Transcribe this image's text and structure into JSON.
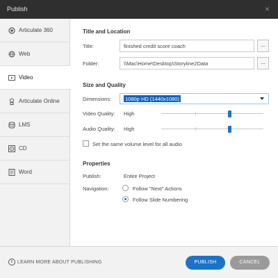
{
  "window": {
    "title": "Publish",
    "close_glyph": "×"
  },
  "sidebar": {
    "items": [
      {
        "label": "Articulate 360",
        "icon": "articulate-360-icon"
      },
      {
        "label": "Web",
        "icon": "globe-icon"
      },
      {
        "label": "Video",
        "icon": "video-icon",
        "active": true
      },
      {
        "label": "Articulate Online",
        "icon": "articulate-online-icon"
      },
      {
        "label": "LMS",
        "icon": "lms-stack-icon"
      },
      {
        "label": "CD",
        "icon": "cd-icon"
      },
      {
        "label": "Word",
        "icon": "word-doc-icon"
      }
    ]
  },
  "title_location": {
    "heading": "Title and Location",
    "title_label": "Title:",
    "title_value": "finished credit score coach",
    "folder_label": "Folder:",
    "folder_value": "\\\\Mac\\Home\\Desktop\\Storyline2Data",
    "browse_label": "..."
  },
  "size_quality": {
    "heading": "Size and Quality",
    "dimensions_label": "Dimensions:",
    "dimensions_value": "1080p HD (1440x1080)",
    "video_quality_label": "Video Quality:",
    "video_quality_value": "High",
    "video_quality_level": 0.67,
    "audio_quality_label": "Audio Quality:",
    "audio_quality_value": "High",
    "audio_quality_level": 0.67,
    "volume_checkbox_label": "Set the same volume level for all audio",
    "volume_checked": false
  },
  "properties": {
    "heading": "Properties",
    "publish_label": "Publish:",
    "publish_value": "Entire Project",
    "navigation_label": "Navigation:",
    "nav_options": [
      "Follow \"Next\" Actions",
      "Follow Slide Numbering"
    ],
    "nav_selected": 1
  },
  "footer": {
    "learn_more": "LEARN MORE ABOUT PUBLISHING",
    "publish_button": "PUBLISH",
    "cancel_button": "CANCEL"
  },
  "colors": {
    "accent": "#1a73c8",
    "titlebar": "#2f2f2f",
    "cancel": "#9a9a9a"
  }
}
